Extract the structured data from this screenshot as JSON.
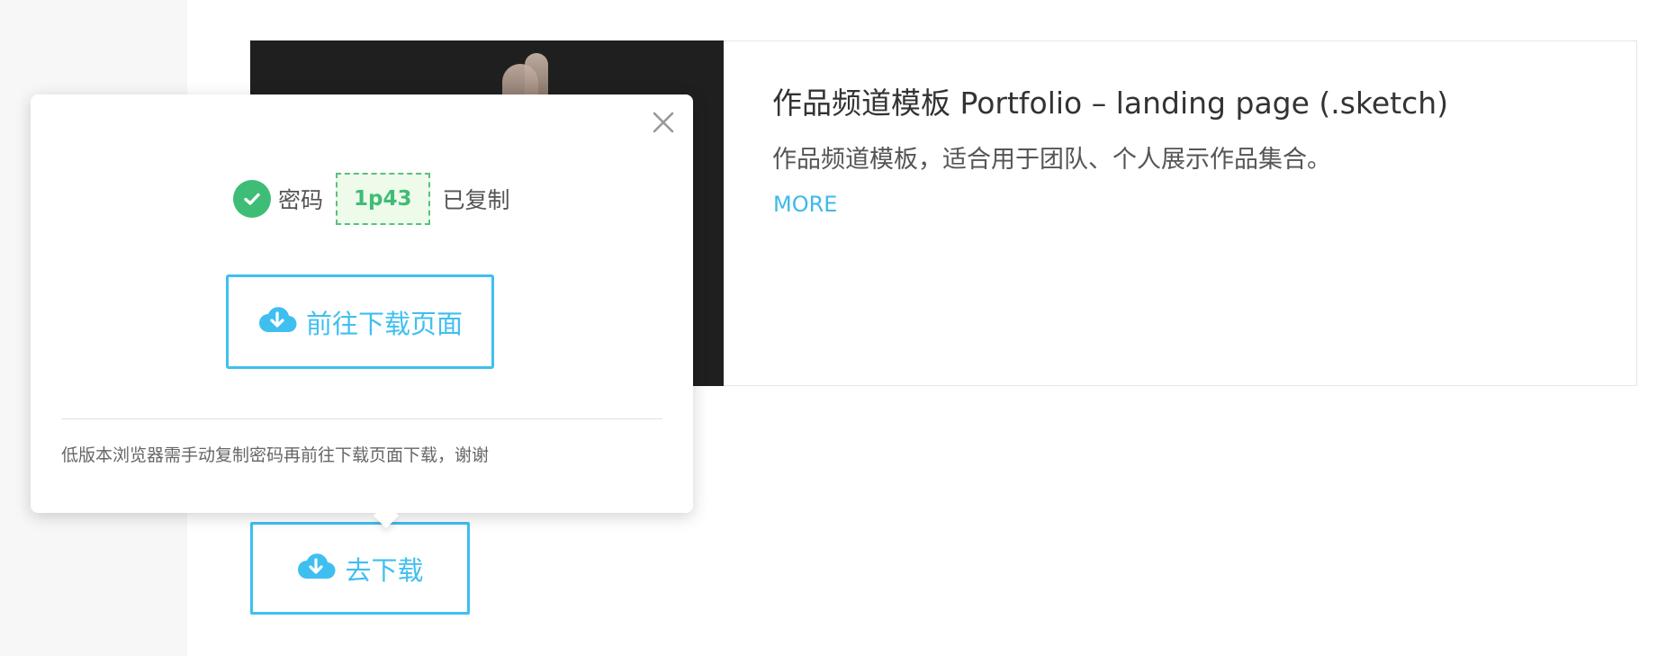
{
  "card": {
    "title": "作品频道模板 Portfolio – landing page (.sketch)",
    "description": "作品频道模板，适合用于团队、个人展示作品集合。",
    "more_label": "MORE"
  },
  "download_button": {
    "label": "去下载",
    "icon": "cloud-download-icon"
  },
  "popup": {
    "password_label": "密码",
    "password_code": "1p43",
    "copied_label": "已复制",
    "goto_label": "前往下载页面",
    "note": "低版本浏览器需手动复制密码再前往下载页面下载，谢谢"
  },
  "colors": {
    "accent": "#3fbff0",
    "success": "#3ebd76",
    "code_bg": "#effbea"
  }
}
